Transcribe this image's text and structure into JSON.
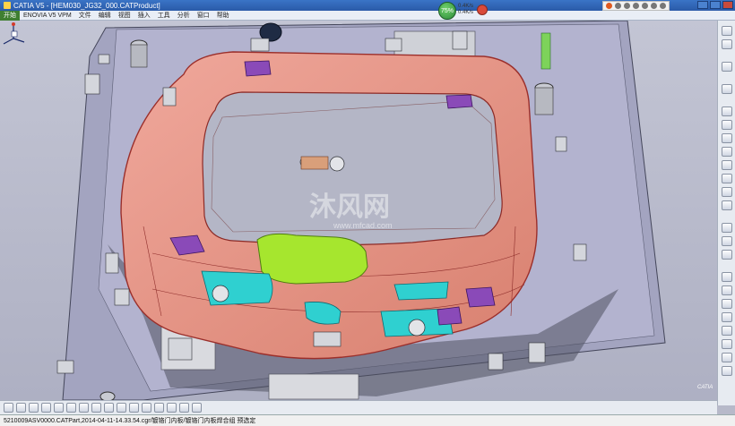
{
  "window": {
    "title": "CATIA V5 - [HEM030_JG32_000.CATProduct]"
  },
  "menubar": {
    "start_label": "开始",
    "items": [
      "ENOVIA V5 VPM",
      "文件",
      "编辑",
      "视图",
      "插入",
      "工具",
      "分析",
      "窗口",
      "帮助"
    ]
  },
  "tray": {
    "badge_label": "75%",
    "speed_up": "0.4K/s",
    "speed_down": "0.4K/s"
  },
  "viewport": {
    "watermark": "沐风网",
    "watermark_sub": "www.mfcad.com",
    "colors": {
      "fixture_base": "#a9a9c5",
      "door_panel": "#e99a8e",
      "door_edge": "#b33a35",
      "highlight_part": "#a6e62e",
      "cyan_part": "#2fd0d0",
      "purple_part": "#8a4ab8",
      "frame_steel": "#c4c6cc"
    }
  },
  "status_bar": {
    "text": "5210009ASV0000.CATPart,2014-04-11-14.33.54.cgr/镀铬门内板/镀铬门内板焊合组 预选定"
  },
  "branding": {
    "logo_text": "CATIA"
  },
  "icons": {
    "right_toolbar": [
      "sketcher-icon",
      "compass-icon",
      "cut-icon",
      "undo-icon",
      "measure-icon",
      "constraint-icon",
      "assembly-icon",
      "part-icon",
      "product-icon",
      "render-icon",
      "analysis-icon",
      "light-icon",
      "ok-icon",
      "snap-icon",
      "clash-icon",
      "section-icon",
      "bom-icon",
      "scene-icon",
      "camera-icon",
      "publish-icon",
      "lamp-icon",
      "flag-icon",
      "group-icon"
    ],
    "bottom_toolbar": [
      "select-icon",
      "fit-all-icon",
      "pan-icon",
      "rotate-icon",
      "zoom-in-icon",
      "zoom-out-icon",
      "normal-view-icon",
      "iso-view-icon",
      "shading-icon",
      "hide-icon",
      "swap-icon",
      "layer-icon",
      "render-style-icon",
      "cube-view-icon",
      "properties-icon",
      "viewpoint-icon"
    ]
  }
}
